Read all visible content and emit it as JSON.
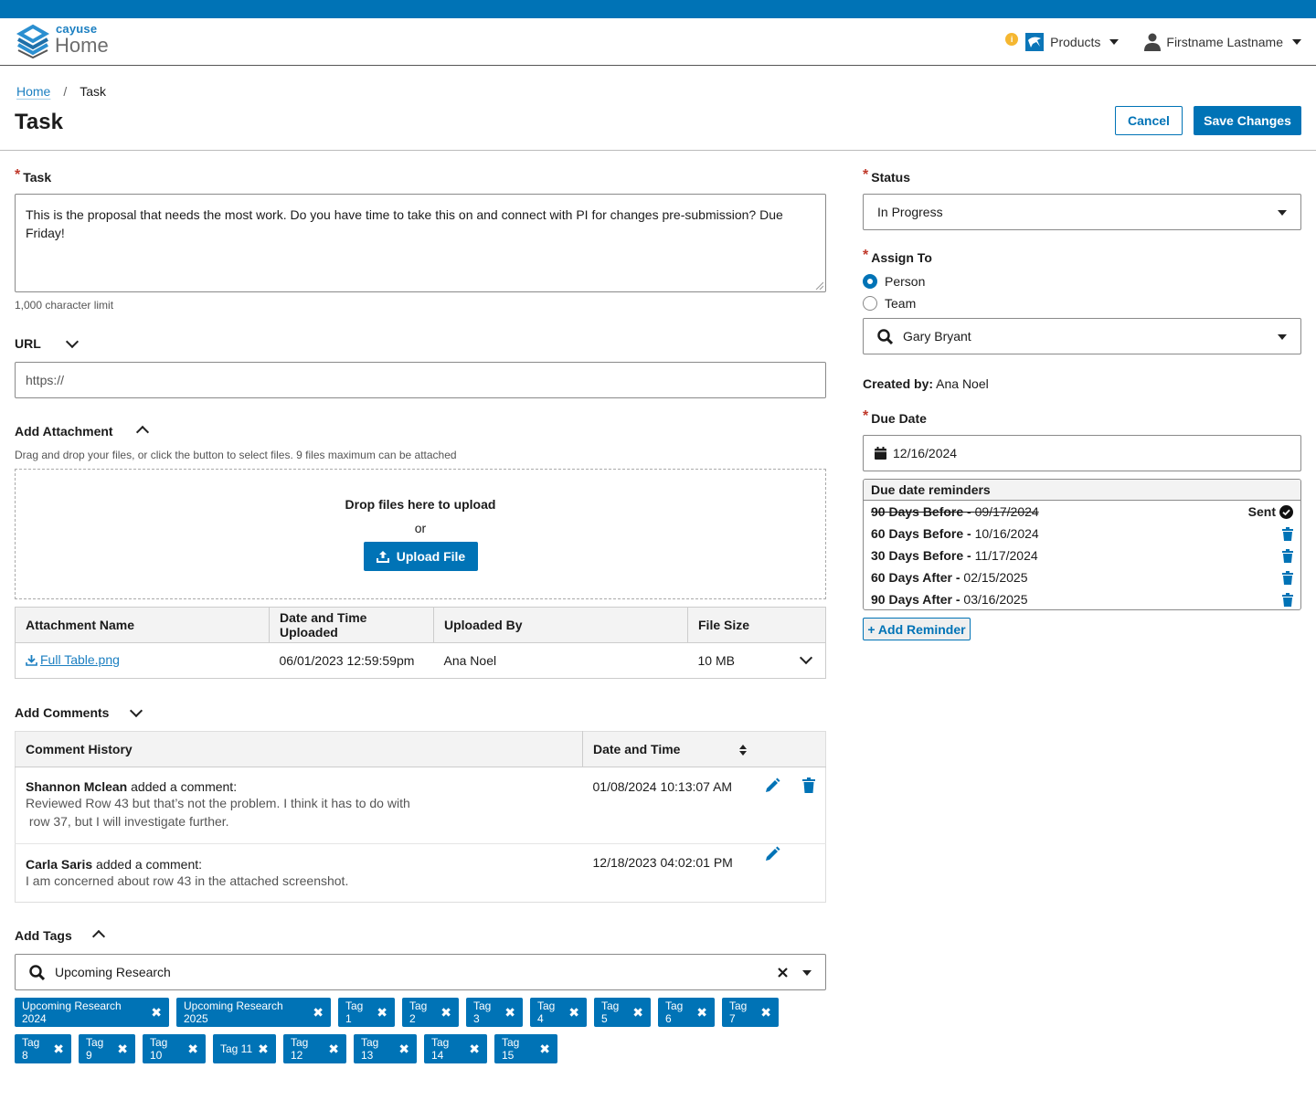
{
  "header": {
    "brand": "cayuse",
    "app_name": "Home",
    "products_label": "Products",
    "user_name": "Firstname Lastname",
    "info_badge": "i"
  },
  "breadcrumb": {
    "home": "Home",
    "separator": "/",
    "current": "Task"
  },
  "page": {
    "title": "Task",
    "cancel_label": "Cancel",
    "save_label": "Save Changes"
  },
  "task": {
    "label": "Task",
    "required_marker": "*",
    "value": "This is the proposal that needs the most work. Do you have time to take this on and connect with PI for changes pre-submission? Due Friday!",
    "char_limit": "1,000 character limit"
  },
  "url": {
    "label": "URL",
    "placeholder": "https://"
  },
  "attachment": {
    "label": "Add Attachment",
    "hint": "Drag and drop your files, or click the button to select files. 9 files maximum can be attached",
    "drop_title": "Drop files here to upload",
    "or": "or",
    "upload_label": "Upload File",
    "columns": [
      "Attachment Name",
      "Date and Time Uploaded",
      "Uploaded By",
      "File Size"
    ],
    "rows": [
      {
        "name": "Full Table.png",
        "date": "06/01/2023 12:59:59pm",
        "by": "Ana Noel",
        "size": "10 MB"
      }
    ]
  },
  "comments": {
    "label": "Add Comments",
    "columns": [
      "Comment History",
      "Date and Time"
    ],
    "rows": [
      {
        "author": "Shannon Mclean",
        "action": " added a comment:",
        "body_line1": "Reviewed Row 43 but that’s not the problem. I think it has to do with",
        "body_line2": " row 37, but I will investigate further.",
        "date": "01/08/2024 10:13:07 AM"
      },
      {
        "author": "Carla Saris",
        "action": " added a comment:",
        "body_line1": "I am concerned about row 43 in the attached screenshot.",
        "date": "12/18/2023 04:02:01 PM"
      }
    ]
  },
  "tags": {
    "label": "Add Tags",
    "search_value": "Upcoming Research",
    "items": [
      "Upcoming Research 2024",
      "Upcoming Research 2025",
      "Tag 1",
      "Tag 2",
      "Tag 3",
      "Tag 4",
      "Tag 5",
      "Tag 6",
      "Tag 7",
      "Tag 8",
      "Tag 9",
      "Tag 10",
      "Tag 11",
      "Tag 12",
      "Tag 13",
      "Tag 14",
      "Tag 15"
    ],
    "remove_glyph": "✖"
  },
  "status": {
    "label": "Status",
    "value": "In Progress"
  },
  "assign": {
    "label": "Assign To",
    "options": [
      "Person",
      "Team"
    ],
    "selected": "Person",
    "assignee": "Gary Bryant"
  },
  "created_by": {
    "label": "Created by:",
    "value": " Ana Noel"
  },
  "due_date": {
    "label": "Due Date",
    "value": "12/16/2024"
  },
  "reminders": {
    "title": "Due date reminders",
    "items": [
      {
        "label": "90 Days Before - ",
        "date": "09/17/2024",
        "status": "Sent"
      },
      {
        "label": "60 Days Before - ",
        "date": "10/16/2024"
      },
      {
        "label": "30 Days Before - ",
        "date": "11/17/2024"
      },
      {
        "label": "60 Days After - ",
        "date": "02/15/2025"
      },
      {
        "label": "90 Days After - ",
        "date": "03/16/2025"
      }
    ],
    "add_label": "+ Add Reminder"
  },
  "colors": {
    "primary": "#0073b6",
    "required": "#c0392b",
    "info": "#f5b731"
  }
}
